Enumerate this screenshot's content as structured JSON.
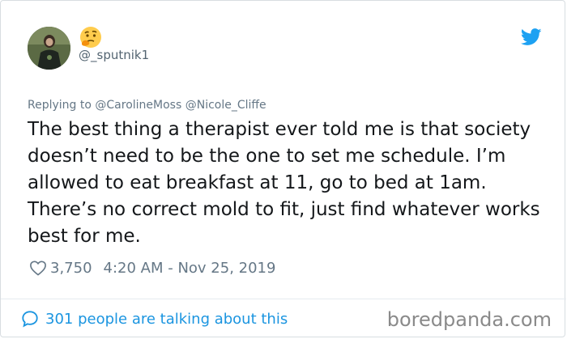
{
  "tweet": {
    "handle": "@_sputnik1",
    "display_emoji": "thinking-face-emoji",
    "replying_prefix": "Replying to",
    "replying_to": [
      "@CarolineMoss",
      "@Nicole_Cliffe"
    ],
    "text": "The best thing a therapist ever told me is that society doesn’t need to be the one to set me schedule. I’m allowed to eat breakfast at 11, go to bed at 1am. There’s no correct mold to fit, just find whatever works best for me.",
    "likes": "3,750",
    "timestamp": "4:20 AM - Nov 25, 2019"
  },
  "footer": {
    "talking_label": "301 people are talking about this",
    "brand": "boredpanda.com"
  },
  "colors": {
    "accent": "#1b95e0",
    "text": "#14171a",
    "muted": "#657786",
    "twitter_blue": "#1da1f2"
  }
}
